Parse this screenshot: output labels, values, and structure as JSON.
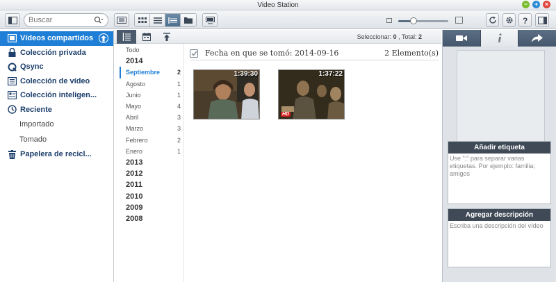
{
  "window": {
    "title": "Video Station"
  },
  "toolbar": {
    "search_placeholder": "Buscar",
    "zoom_level": 0.3
  },
  "sidebar": {
    "items": [
      {
        "label": "Vídeos compartidos",
        "icon": "shared-videos-icon"
      },
      {
        "label": "Colección privada",
        "icon": "lock-icon"
      },
      {
        "label": "Qsync",
        "icon": "qsync-icon"
      },
      {
        "label": "Colección de vídeo",
        "icon": "video-collection-icon"
      },
      {
        "label": "Colección inteligen...",
        "icon": "smart-collection-icon"
      },
      {
        "label": "Reciente",
        "icon": "clock-icon"
      },
      {
        "label": "Importado",
        "icon": ""
      },
      {
        "label": "Tomado",
        "icon": ""
      },
      {
        "label": "Papelera de recicl...",
        "icon": "trash-icon"
      }
    ]
  },
  "timeline": {
    "items": [
      {
        "label": "Todo",
        "count": ""
      },
      {
        "label": "2014",
        "count": ""
      },
      {
        "label": "Septiembre",
        "count": "2"
      },
      {
        "label": "Agosto",
        "count": "1"
      },
      {
        "label": "Junio",
        "count": "1"
      },
      {
        "label": "Mayo",
        "count": "4"
      },
      {
        "label": "Abril",
        "count": "3"
      },
      {
        "label": "Marzo",
        "count": "3"
      },
      {
        "label": "Febrero",
        "count": "2"
      },
      {
        "label": "Enero",
        "count": "1"
      },
      {
        "label": "2013",
        "count": ""
      },
      {
        "label": "2012",
        "count": ""
      },
      {
        "label": "2011",
        "count": ""
      },
      {
        "label": "2010",
        "count": ""
      },
      {
        "label": "2009",
        "count": ""
      },
      {
        "label": "2008",
        "count": ""
      }
    ]
  },
  "main": {
    "select_label": "Seleccionar: ",
    "select_count": "0",
    "total_label": " , Total: ",
    "total_count": "2",
    "group_title": "Fecha en que se tomó: 2014-09-16",
    "group_count": "2 Elemento(s)",
    "videos": [
      {
        "duration": "1:39:30",
        "hd": ""
      },
      {
        "duration": "1:37:22",
        "hd": "HD"
      }
    ]
  },
  "right_panel": {
    "tag_title": "Añadir etiqueta",
    "tag_hint": "Use \";\" para separar varias etiquetas. Por ejemplo: familia; amigos",
    "desc_title": "Agregar descripción",
    "desc_hint": "Escriba una descripción del vídeo"
  },
  "colors": {
    "accent": "#1f7fd6",
    "dark_header": "#3f4a56"
  }
}
